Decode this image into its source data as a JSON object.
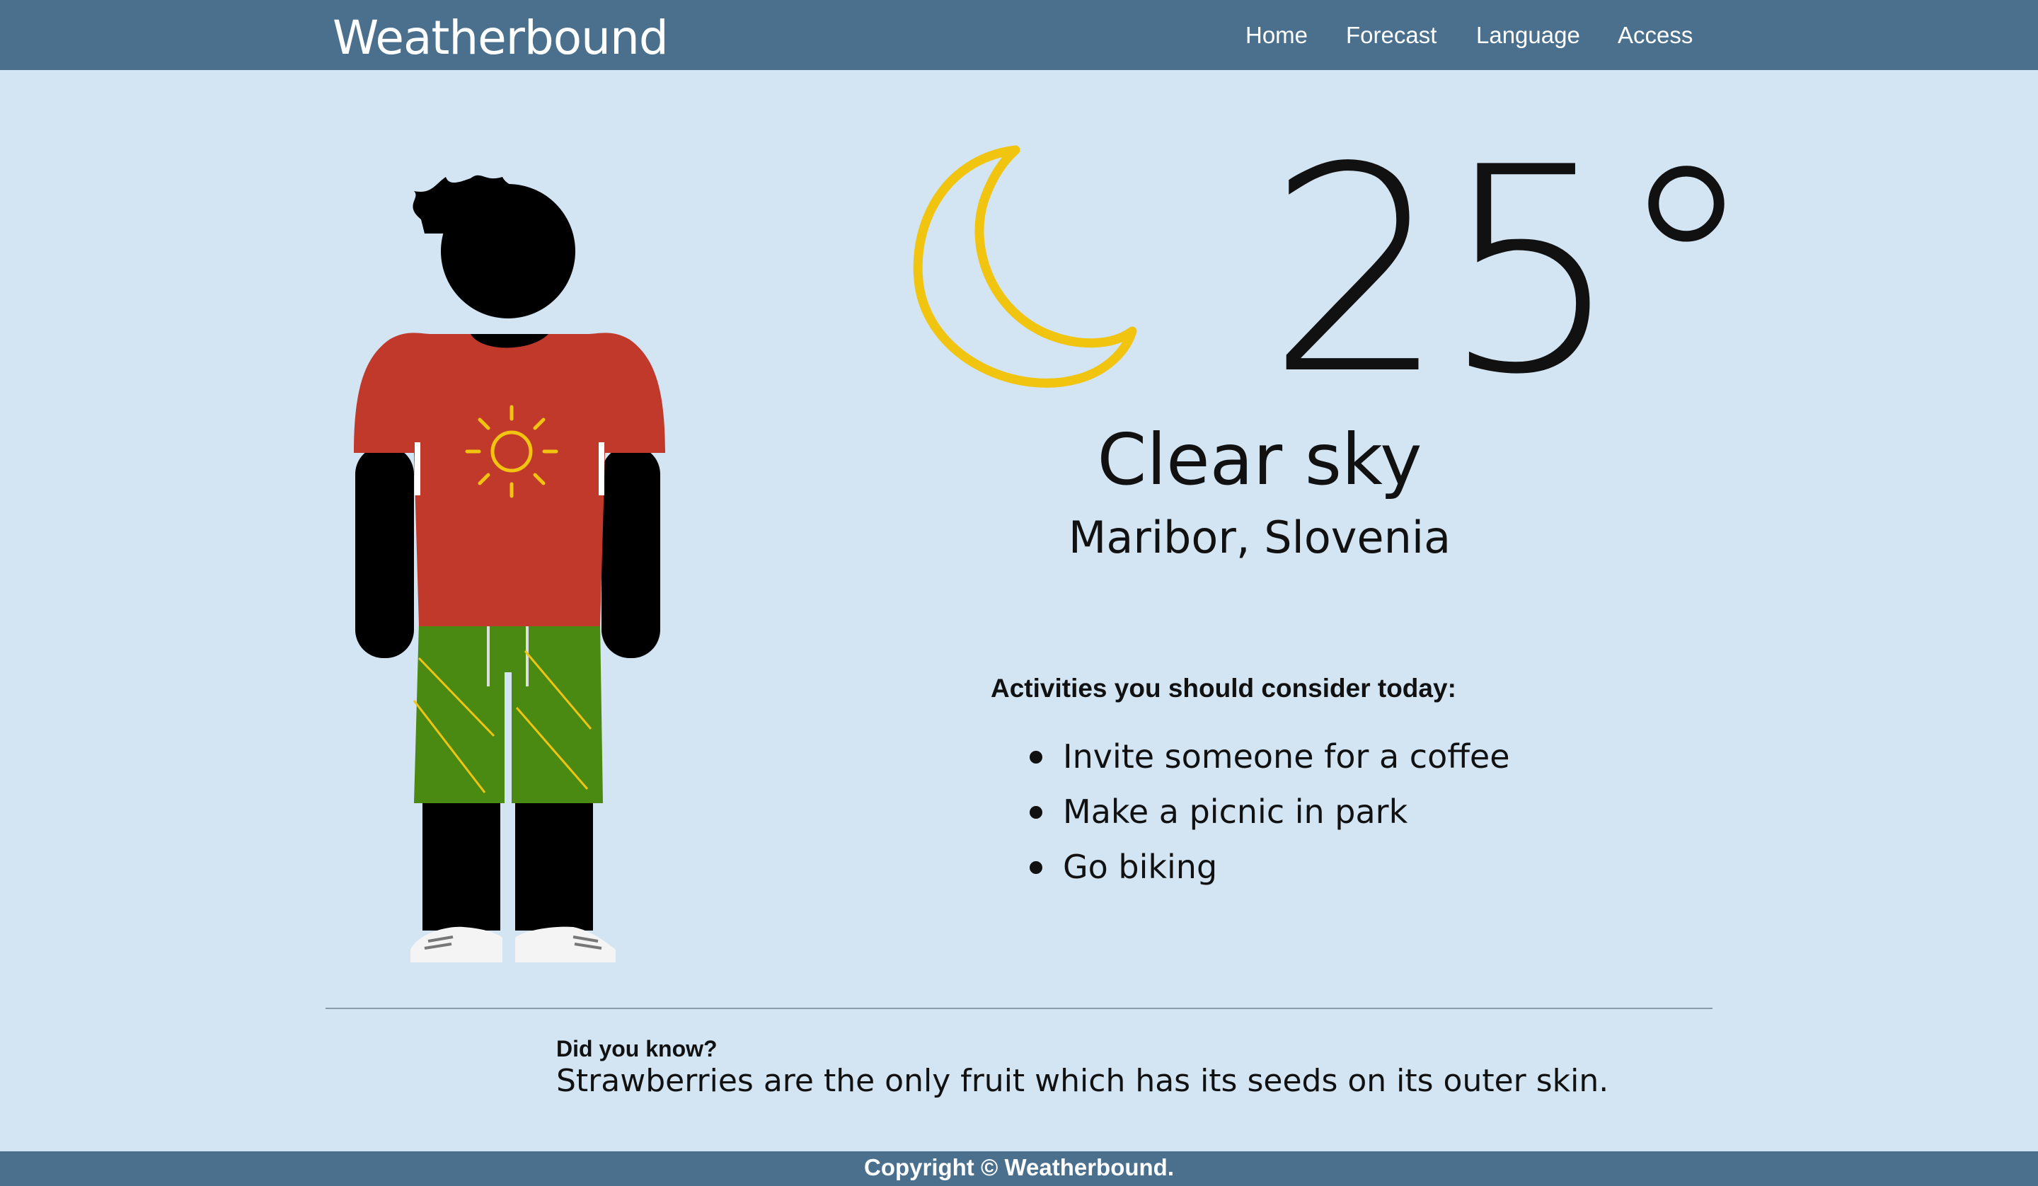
{
  "navbar": {
    "brand": "Weatherbound",
    "links": [
      {
        "label": "Home"
      },
      {
        "label": "Forecast"
      },
      {
        "label": "Language"
      },
      {
        "label": "Access"
      }
    ],
    "color": "#4b708d"
  },
  "weather": {
    "icon": "crescent-moon-icon",
    "temperature": "25°",
    "condition": "Clear sky",
    "location": "Maribor, Slovenia"
  },
  "outfit": {
    "icon": "person-outfit-illustration",
    "shirt_color": "#c0392b",
    "shorts_color": "#4a8a12",
    "accent_color": "#f1c40f"
  },
  "activities": {
    "title": "Activities you should consider today:",
    "items": [
      "Invite someone for a coffee",
      "Make a picnic in park",
      "Go biking"
    ]
  },
  "did_you_know": {
    "title": "Did you know?",
    "text": "Strawberries are the only fruit which has its seeds on its outer skin."
  },
  "footer": {
    "text": "Copyright © Weatherbound."
  },
  "colors": {
    "background": "#d3e5f3",
    "moon": "#f1c40f"
  }
}
